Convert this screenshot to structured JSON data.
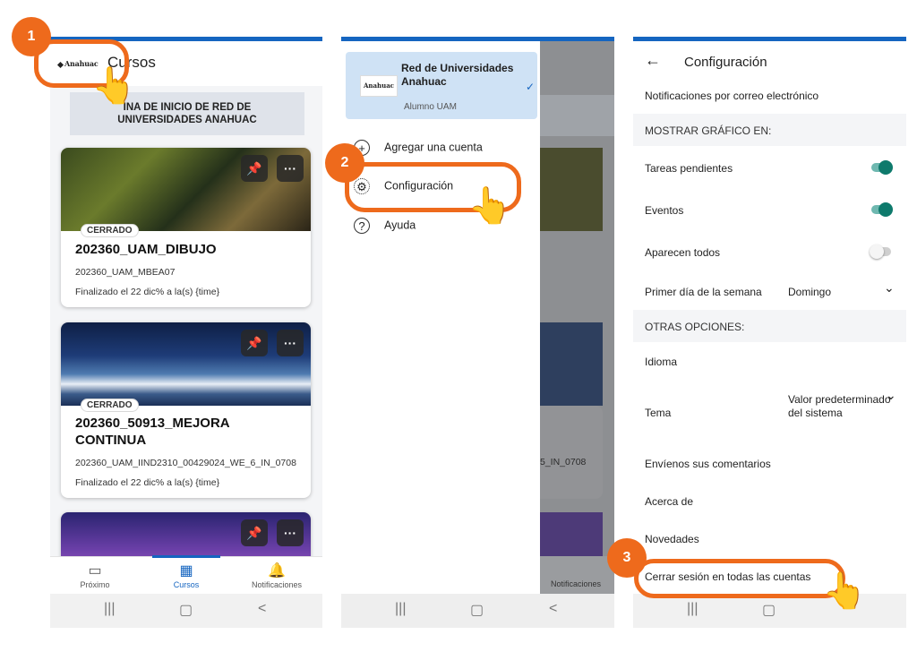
{
  "panel1": {
    "header_logo": "Anahuac",
    "header_title": "Cursos",
    "banner": "PÁGINA DE INICIO DE RED DE UNIVERSIDADES ANAHUAC",
    "banner_visible": "INA DE INICIO DE RED DE\nUNIVERSIDADES ANAHUAC",
    "courses": [
      {
        "status": "CERRADO",
        "title": "202360_UAM_DIBUJO",
        "code": "202360_UAM_MBEA07",
        "finished": "Finalizado el 22 dic% a la(s) {time}"
      },
      {
        "status": "CERRADO",
        "title": "202360_50913_MEJORA CONTINUA",
        "code": "202360_UAM_IIND2310_00429024_WE_6_IN_0708",
        "finished": "Finalizado el 22 dic% a la(s) {time}"
      }
    ],
    "nav": [
      {
        "label": "Próximo",
        "icon": "calendar-icon"
      },
      {
        "label": "Cursos",
        "icon": "grid-icon"
      },
      {
        "label": "Notificaciones",
        "icon": "bell-icon"
      }
    ]
  },
  "panel2": {
    "account_name": "Red de Universidades Anahuac",
    "account_user": "Alumno UAM",
    "account_logo": "Anahuac",
    "menu": [
      {
        "label": "Agregar una cuenta",
        "icon": "plus-circle-icon"
      },
      {
        "label": "Configuración",
        "icon": "gear-icon"
      },
      {
        "label": "Ayuda",
        "icon": "help-icon"
      }
    ],
    "behind_code_fragment": "5_IN_0708",
    "behind_nav_label": "Notificaciones"
  },
  "panel3": {
    "title": "Configuración",
    "email_notifications": "Notificaciones por correo electrónico",
    "section_chart": "MOSTRAR GRÁFICO EN:",
    "toggles": [
      {
        "label": "Tareas pendientes",
        "on": true
      },
      {
        "label": "Eventos",
        "on": true
      },
      {
        "label": "Aparecen todos",
        "on": false
      }
    ],
    "first_day_label": "Primer día de la semana",
    "first_day_value": "Domingo",
    "section_other": "OTRAS OPCIONES:",
    "language": "Idioma",
    "theme_label": "Tema",
    "theme_value": "Valor predeterminado del sistema",
    "feedback": "Envíenos sus comentarios",
    "about": "Acerca de",
    "news": "Novedades",
    "logout_all": "Cerrar sesión en todas las cuentas"
  },
  "steps": [
    "1",
    "2",
    "3"
  ],
  "colors": {
    "accent": "#ee6a1c",
    "topbar": "#1565c0",
    "toggle_on": "#0e7a6c",
    "selected_account_bg": "#cfe2f5"
  }
}
